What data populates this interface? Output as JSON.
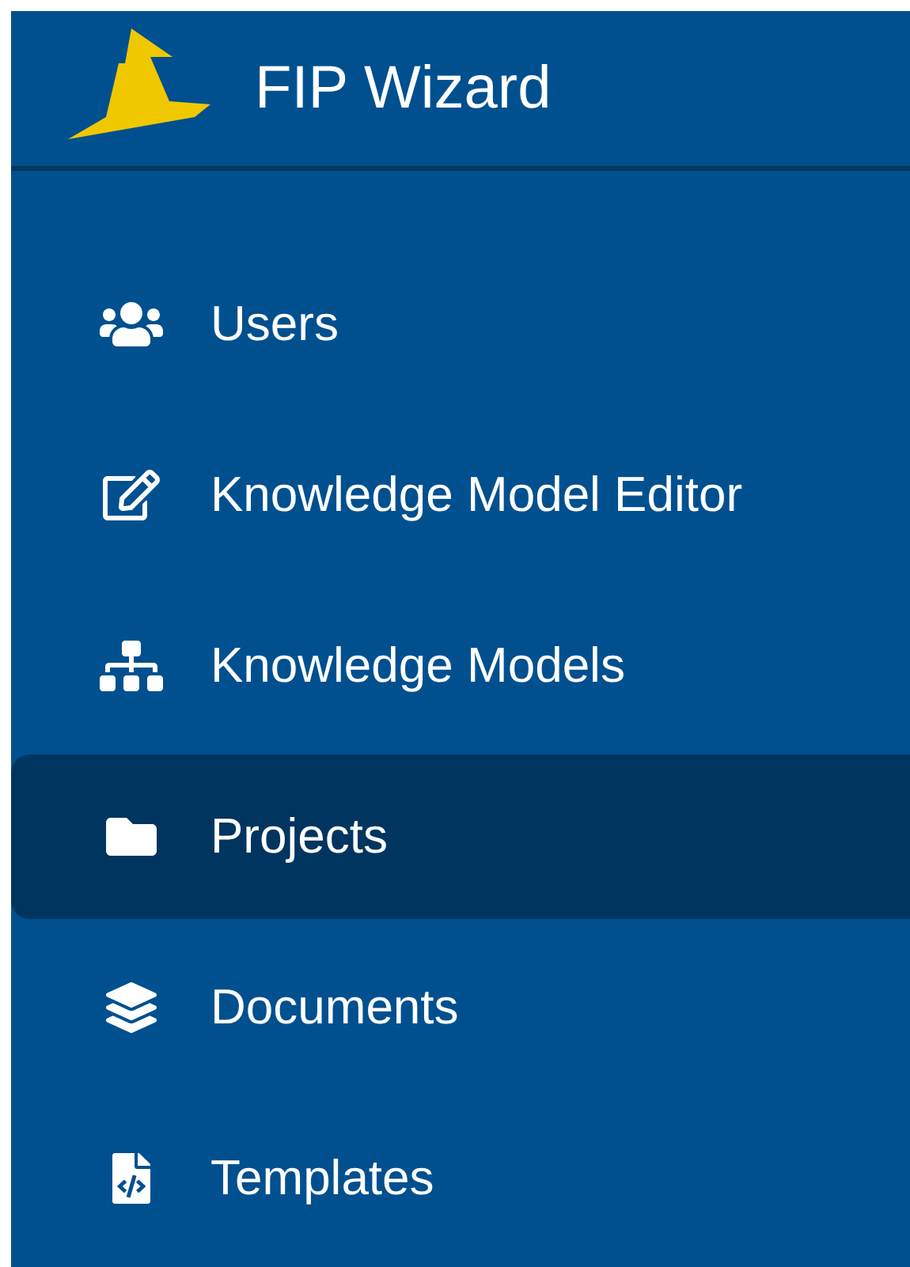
{
  "app": {
    "title": "FIP Wizard"
  },
  "menu": [
    {
      "label": "Users",
      "selected": false
    },
    {
      "label": "Knowledge Model Editor",
      "selected": false
    },
    {
      "label": "Knowledge Models",
      "selected": false
    },
    {
      "label": "Projects",
      "selected": true
    },
    {
      "label": "Documents",
      "selected": false
    },
    {
      "label": "Templates",
      "selected": false
    }
  ]
}
